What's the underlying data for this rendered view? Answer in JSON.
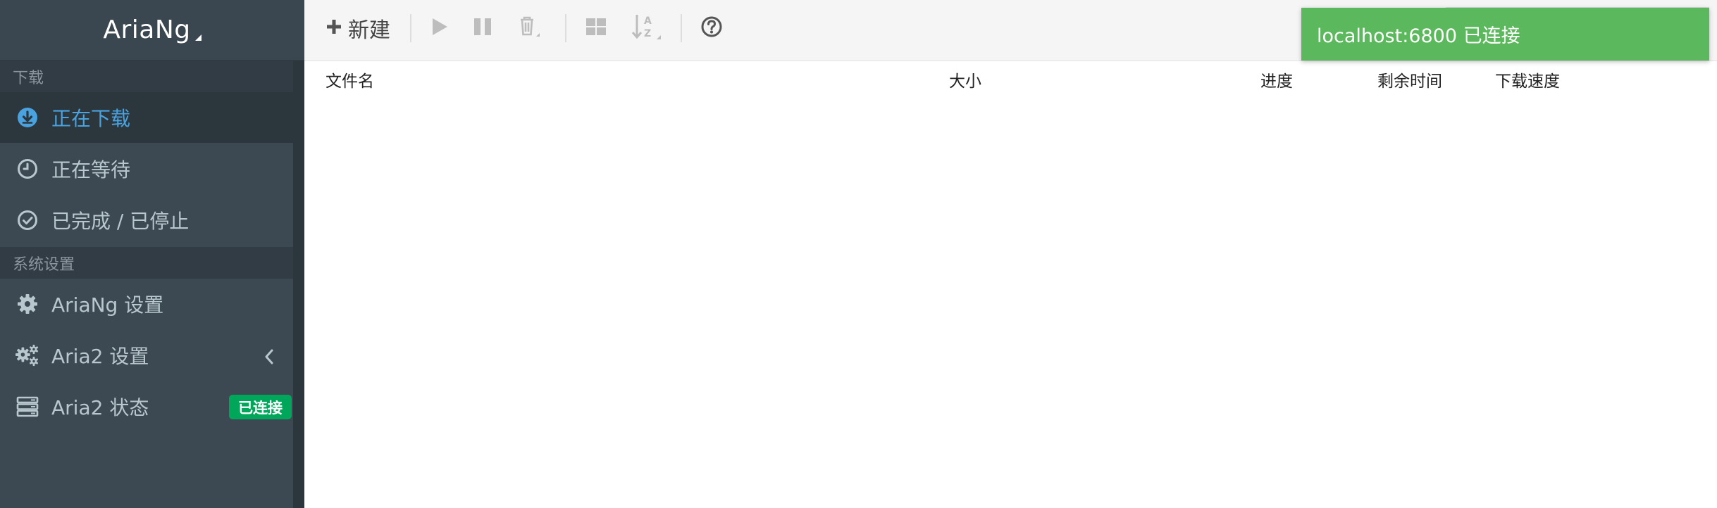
{
  "app": {
    "title": "AriaNg"
  },
  "sidebar": {
    "sections": [
      {
        "header": "下载",
        "items": [
          {
            "label": "正在下载",
            "icon": "download-circle-icon",
            "active": true
          },
          {
            "label": "正在等待",
            "icon": "clock-icon",
            "active": false
          },
          {
            "label": "已完成 / 已停止",
            "icon": "check-circle-icon",
            "active": false
          }
        ]
      },
      {
        "header": "系统设置",
        "items": [
          {
            "label": "AriaNg 设置",
            "icon": "gear-icon"
          },
          {
            "label": "Aria2 设置",
            "icon": "gears-icon",
            "chevron": "chevron-left-icon"
          },
          {
            "label": "Aria2 状态",
            "icon": "server-icon",
            "badge": "已连接"
          }
        ]
      }
    ]
  },
  "toolbar": {
    "new_label": "新建",
    "buttons": [
      "plus-icon",
      "play-icon",
      "pause-icon",
      "trash-icon",
      "grid-icon",
      "sort-az-icon",
      "help-icon"
    ]
  },
  "table": {
    "columns": [
      "文件名",
      "大小",
      "进度",
      "剩余时间",
      "下载速度"
    ]
  },
  "toast": {
    "message": "localhost:6800 已连接"
  },
  "colors": {
    "sidebar_bg": "#3c4852",
    "active_text": "#4aa3df",
    "badge_bg": "#00a65a",
    "toast_bg": "#5cb85c"
  }
}
